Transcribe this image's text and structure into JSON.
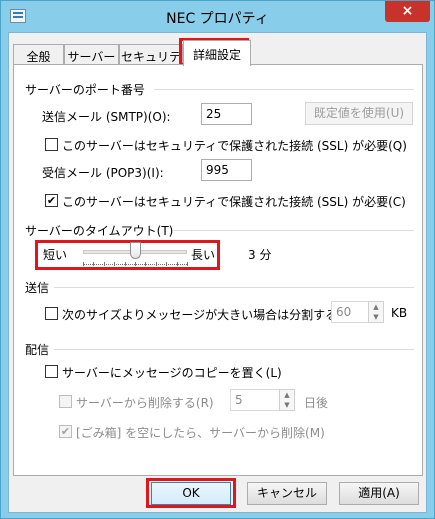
{
  "window": {
    "title": "NEC プロパティ",
    "close_icon": "×"
  },
  "tabs": [
    {
      "label": "全般",
      "active": false
    },
    {
      "label": "サーバー",
      "active": false
    },
    {
      "label": "セキュリティ",
      "active": false
    },
    {
      "label": "詳細設定",
      "active": true
    }
  ],
  "port_section": {
    "title": "サーバーのポート番号",
    "smtp_label": "送信メール (SMTP)(O):",
    "smtp_value": "25",
    "default_button": "既定値を使用(U)",
    "smtp_ssl_label": "このサーバーはセキュリティで保護された接続 (SSL) が必要(Q)",
    "smtp_ssl_checked": false,
    "pop3_label": "受信メール (POP3)(I):",
    "pop3_value": "995",
    "pop3_ssl_label": "このサーバーはセキュリティで保護された接続 (SSL) が必要(C)",
    "pop3_ssl_checked": true
  },
  "timeout_section": {
    "title": "サーバーのタイムアウト(T)",
    "short_label": "短い",
    "long_label": "長い",
    "value_text": "3 分",
    "slider_position": 0.5
  },
  "send_section": {
    "title": "送信",
    "split_label": "次のサイズよりメッセージが大きい場合は分割する(B)",
    "split_checked": false,
    "split_value": "60",
    "split_unit": "KB"
  },
  "delivery_section": {
    "title": "配信",
    "leave_copy_label": "サーバーにメッセージのコピーを置く(L)",
    "leave_copy_checked": false,
    "remove_after_label": "サーバーから削除する(R)",
    "remove_after_checked": false,
    "remove_after_value": "5",
    "remove_after_unit": "日後",
    "remove_deleted_label": "[ごみ箱] を空にしたら、サーバーから削除(M)",
    "remove_deleted_checked": true
  },
  "buttons": {
    "ok": "OK",
    "cancel": "キャンセル",
    "apply": "適用(A)"
  },
  "colors": {
    "highlight": "#e0161d",
    "close_button": "#c7322a"
  }
}
